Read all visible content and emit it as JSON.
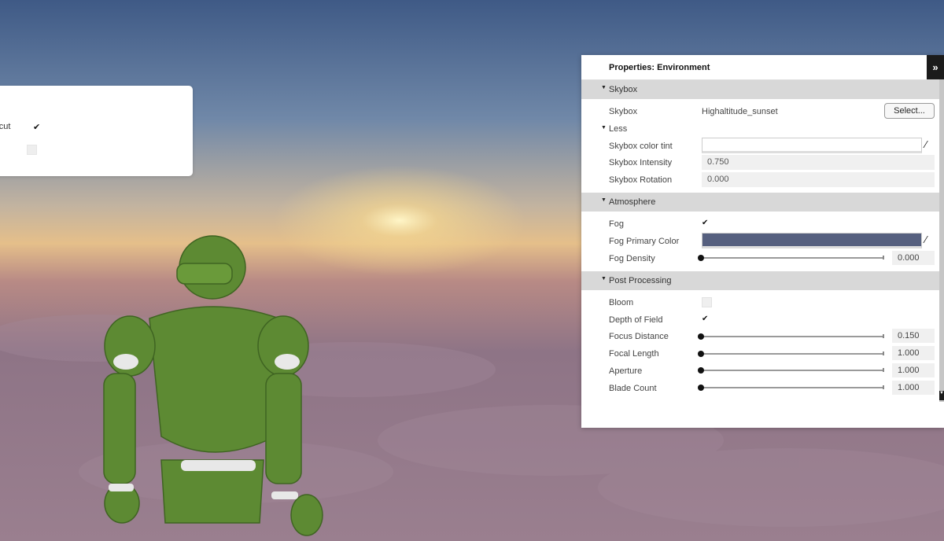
{
  "left_panel": {
    "row1_label": "rtcut",
    "row1_checked": true,
    "row2_checked": false
  },
  "properties": {
    "title": "Properties: Environment",
    "collapse_icon": "double-chevron-right-icon",
    "sections": {
      "skybox": {
        "label": "Skybox",
        "skybox_label": "Skybox",
        "skybox_value": "Highaltitude_sunset",
        "select_button": "Select...",
        "less_label": "Less",
        "tint_label": "Skybox color tint",
        "tint_color": "#ffffff",
        "intensity_label": "Skybox Intensity",
        "intensity_value": "0.750",
        "rotation_label": "Skybox Rotation",
        "rotation_value": "0.000"
      },
      "atmosphere": {
        "label": "Atmosphere",
        "fog_label": "Fog",
        "fog_checked": true,
        "fog_color_label": "Fog Primary Color",
        "fog_color": "#56607f",
        "fog_density_label": "Fog Density",
        "fog_density_value": "0.000"
      },
      "post_processing": {
        "label": "Post Processing",
        "bloom_label": "Bloom",
        "bloom_checked": false,
        "dof_label": "Depth of Field",
        "dof_checked": true,
        "focus_distance_label": "Focus Distance",
        "focus_distance_value": "0.150",
        "focal_length_label": "Focal Length",
        "focal_length_value": "1.000",
        "aperture_label": "Aperture",
        "aperture_value": "1.000",
        "blade_count_label": "Blade Count",
        "blade_count_value": "1.000"
      }
    }
  }
}
